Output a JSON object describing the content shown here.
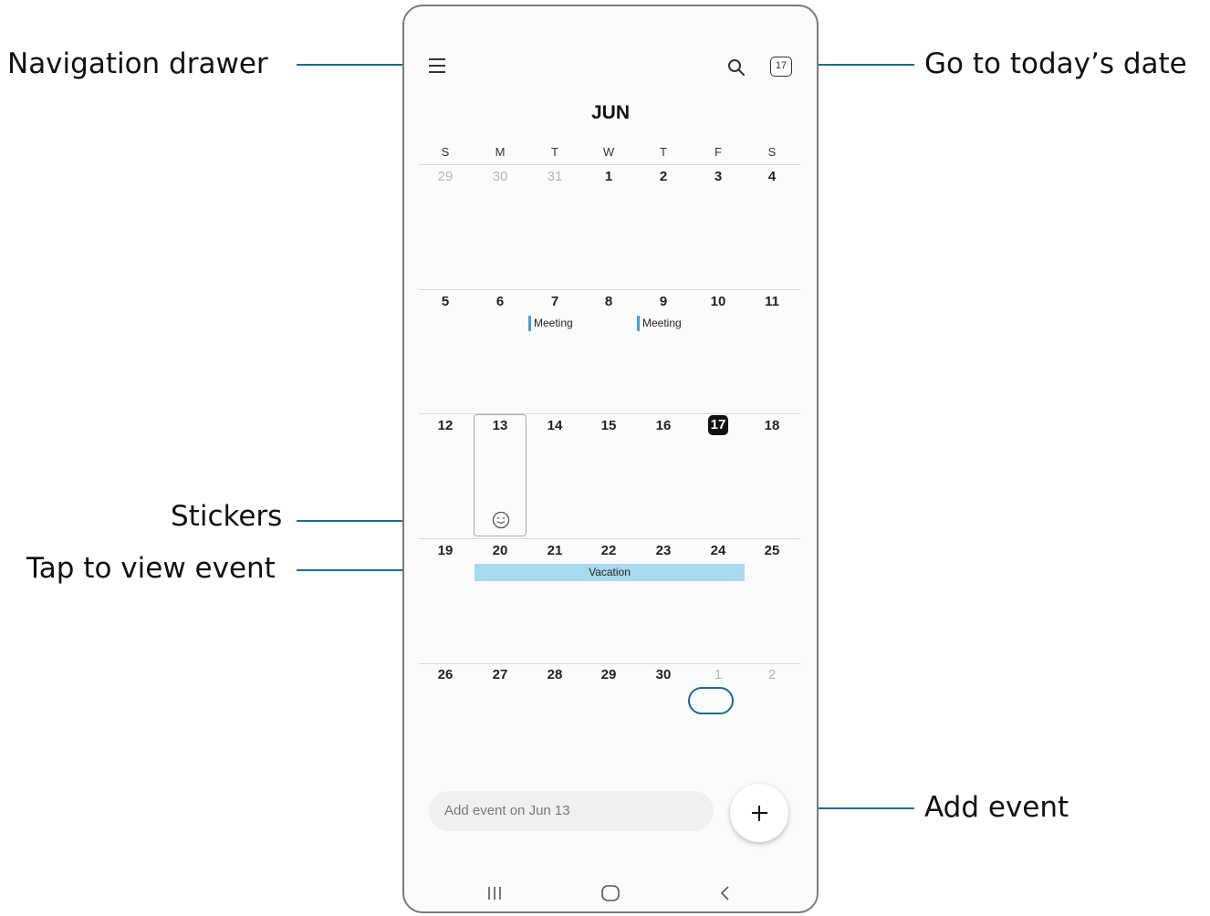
{
  "callouts": {
    "navigation_drawer": "Navigation drawer",
    "go_to_today": "Go to today’s date",
    "stickers": "Stickers",
    "tap_to_view_event": "Tap to view event",
    "add_event": "Add event"
  },
  "app": {
    "month": "JUN",
    "today_icon_label": "17",
    "weekdays": [
      "S",
      "M",
      "T",
      "W",
      "T",
      "F",
      "S"
    ],
    "weeks": [
      [
        "29",
        "30",
        "31",
        "1",
        "2",
        "3",
        "4"
      ],
      [
        "5",
        "6",
        "7",
        "8",
        "9",
        "10",
        "11"
      ],
      [
        "12",
        "13",
        "14",
        "15",
        "16",
        "17",
        "18"
      ],
      [
        "19",
        "20",
        "21",
        "22",
        "23",
        "24",
        "25"
      ],
      [
        "26",
        "27",
        "28",
        "29",
        "30",
        "1",
        "2"
      ]
    ],
    "events": {
      "meeting_1": "Meeting",
      "meeting_2": "Meeting",
      "vacation": "Vacation"
    },
    "add_event_placeholder": "Add event on Jun 13"
  },
  "colors": {
    "callout_line": "#1b6c95",
    "event_accent": "#3aa3e0",
    "vacation_bar": "#a8d9ee"
  },
  "icons": [
    "menu-icon",
    "search-icon",
    "calendar-today-icon",
    "smiley-sticker-icon",
    "plus-icon",
    "recents-icon",
    "home-icon",
    "back-icon"
  ]
}
